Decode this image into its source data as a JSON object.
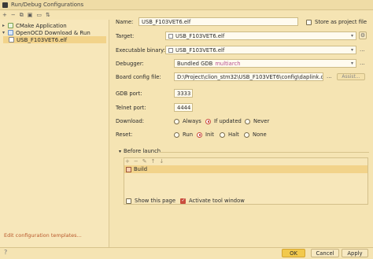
{
  "window": {
    "title": "Run/Debug Configurations"
  },
  "toolbar": {
    "icons": [
      "add-icon",
      "remove-icon",
      "copy-icon",
      "save-icon",
      "folder-icon",
      "sort-icon"
    ]
  },
  "tree": {
    "items": [
      {
        "label": "CMake Application",
        "icon": "cmake-icon",
        "expanded": false
      },
      {
        "label": "OpenOCD Download & Run",
        "icon": "openocd-icon",
        "expanded": true
      },
      {
        "label": "USB_F103VET6.elf",
        "icon": "config-icon",
        "selected": true
      }
    ],
    "edit_templates": "Edit configuration templates..."
  },
  "form": {
    "name_label": "Name:",
    "name_value": "USB_F103VET6.elf",
    "store_label": "Store as project file",
    "target_label": "Target:",
    "target_value": "USB_F103VET6.elf",
    "executable_label": "Executable binary:",
    "executable_value": "USB_F103VET6.elf",
    "debugger_label": "Debugger:",
    "debugger_value": "Bundled GDB",
    "debugger_suffix": "multiarch",
    "board_label": "Board config file:",
    "board_value": "D:\\Project\\clion_stm32\\USB_F103VET6\\config\\daplink.cfg.txt",
    "dots": "...",
    "assist_label": "Assist...",
    "gdb_port_label": "GDB port:",
    "gdb_port_value": "3333",
    "telnet_port_label": "Telnet port:",
    "telnet_port_value": "4444",
    "download_label": "Download:",
    "download_options": [
      "Always",
      "If updated",
      "Never"
    ],
    "download_selected": "If updated",
    "reset_label": "Reset:",
    "reset_options": [
      "Run",
      "Init",
      "Halt",
      "None"
    ],
    "reset_selected": "Init"
  },
  "before_launch": {
    "label": "Before launch",
    "tools": [
      "+",
      "−",
      "✎",
      "↑",
      "↓"
    ],
    "tasks": [
      "Build"
    ],
    "show_page_label": "Show this page",
    "show_page_checked": false,
    "activate_label": "Activate tool window",
    "activate_checked": true
  },
  "footer": {
    "ok": "OK",
    "cancel": "Cancel",
    "apply": "Apply"
  },
  "colors": {
    "accent": "#c94d3d",
    "primary_button": "#f2c94c",
    "background": "#f5e4b3"
  }
}
